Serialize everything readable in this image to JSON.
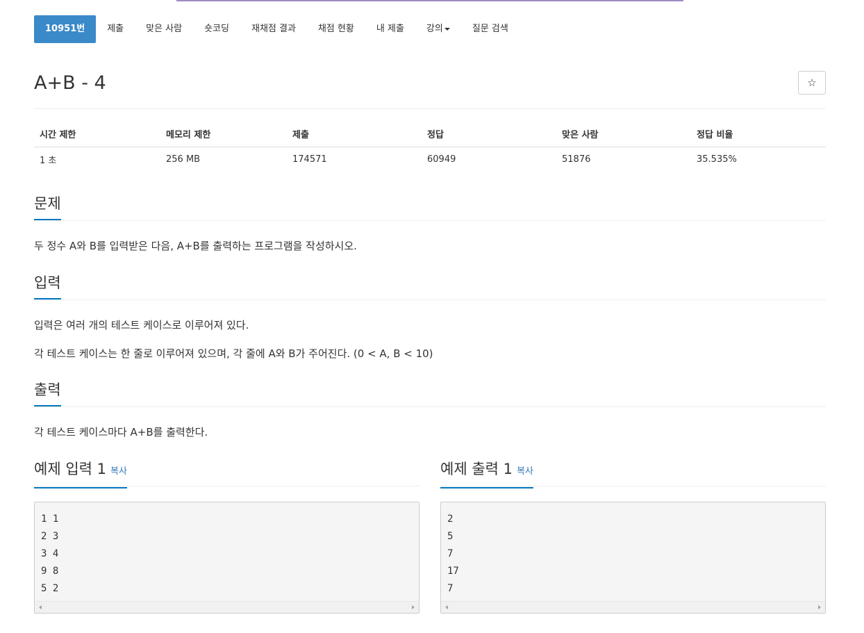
{
  "nav": {
    "items": [
      {
        "label": "10951번"
      },
      {
        "label": "제출"
      },
      {
        "label": "맞은 사람"
      },
      {
        "label": "숏코딩"
      },
      {
        "label": "재채점 결과"
      },
      {
        "label": "채점 현황"
      },
      {
        "label": "내 제출"
      },
      {
        "label": "강의"
      },
      {
        "label": "질문 검색"
      }
    ],
    "active_color": "#3a89c9"
  },
  "problem": {
    "title": "A+B - 4",
    "star": "☆"
  },
  "info_table": {
    "headers": [
      "시간 제한",
      "메모리 제한",
      "제출",
      "정답",
      "맞은 사람",
      "정답 비율"
    ],
    "row": [
      "1 초",
      "256 MB",
      "174571",
      "60949",
      "51876",
      "35.535%"
    ]
  },
  "sections": {
    "description": {
      "title": "문제",
      "text": "두 정수 A와 B를 입력받은 다음, A+B를 출력하는 프로그램을 작성하시오."
    },
    "input": {
      "title": "입력",
      "lines": [
        "입력은 여러 개의 테스트 케이스로 이루어져 있다.",
        "각 테스트 케이스는 한 줄로 이루어져 있으며, 각 줄에 A와 B가 주어진다. (0 < A, B < 10)"
      ]
    },
    "output": {
      "title": "출력",
      "text": "각 테스트 케이스마다 A+B를 출력한다."
    }
  },
  "samples": {
    "input": {
      "title": "예제 입력 1",
      "copy": "복사",
      "content": "1 1\n2 3\n3 4\n9 8\n5 2"
    },
    "output": {
      "title": "예제 출력 1",
      "copy": "복사",
      "content": "2\n5\n7\n17\n7"
    }
  },
  "colors": {
    "accent": "#0076c0",
    "link": "#337ab7"
  }
}
